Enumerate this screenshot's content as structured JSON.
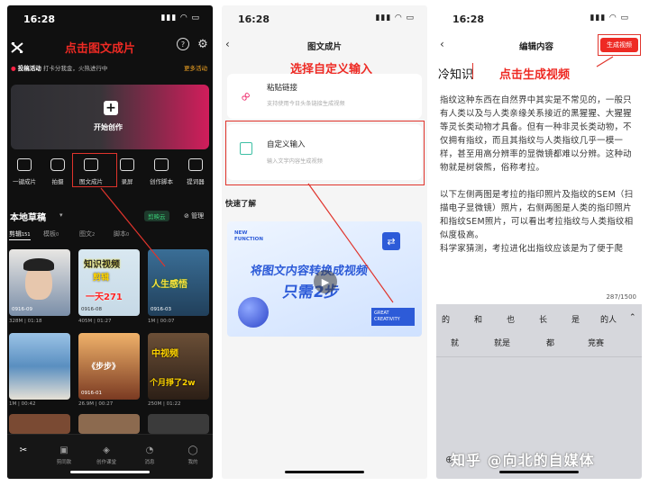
{
  "status": {
    "time": "16:28"
  },
  "phone1": {
    "annotation": "点击图文成片",
    "promo_tag": "投稿活动",
    "promo_text": "打卡分我金，火热进行中",
    "promo_more": "更多活动",
    "start_label": "开始创作",
    "tools": [
      "一键成片",
      "拍摄",
      "图文成片",
      "录屏",
      "创作脚本",
      "提词器"
    ],
    "drafts_title": "本地草稿",
    "cloud_label": "剪映云",
    "manage_label": "管理",
    "tabs": [
      "剪辑",
      "模板",
      "图文",
      "脚本"
    ],
    "tab_counts": [
      "151",
      "0",
      "2",
      "0"
    ],
    "items": [
      {
        "date": "0916-09",
        "size": "328M",
        "duration": "01:18"
      },
      {
        "date": "0916-08",
        "size": "405M",
        "duration": "01:27",
        "overlay1": "知识视频",
        "overlay2": "剪辑",
        "overlay3": "一天271"
      },
      {
        "date": "0916-03",
        "size": "1M",
        "duration": "00:07",
        "overlay1": "人生感悟"
      },
      {
        "date": "",
        "size": "1M",
        "duration": "00:42"
      },
      {
        "date": "0916-01",
        "size": "26.9M",
        "duration": "00:27",
        "overlay1": "《步步》"
      },
      {
        "date": "",
        "size": "250M",
        "duration": "01:22",
        "overlay1": "中视频",
        "overlay2": "个月掙了2w"
      }
    ],
    "nav": [
      "剪辑",
      "剪同款",
      "创作课堂",
      "消息",
      "我的"
    ]
  },
  "phone2": {
    "title": "图文成片",
    "annotation": "选择自定义输入",
    "paste_title": "粘贴链接",
    "paste_desc": "支持使用今日头条链接生成视频",
    "custom_title": "自定义输入",
    "custom_desc": "输入文字内容生成视频",
    "quick_title": "快速了解",
    "banner_small": "NEW FUNCTION",
    "banner_line1": "将图文内容转换成视频",
    "banner_line2": "只需2步",
    "banner_badge": "GREAT CREATIVITY"
  },
  "phone3": {
    "title": "编辑内容",
    "generate_label": "生成视频",
    "annotation": "点击生成视频",
    "doc_title": "冷知识",
    "body": [
      "指纹这种东西在自然界中其实是不常见的，一般只有人类以及与人类亲缘关系接近的黑猩猩、大猩猩等灵长类动物才具备。但有一种非灵长类动物，不仅拥有指纹，而且其指纹与人类指纹几乎一模一样，甚至用高分辨率的显微镜都难以分辨。这种动物就是树袋熊，俗称考拉。",
      "以下左侧两图是考拉的指印照片及指纹的SEM（扫描电子显微镜）照片，右侧两图是人类的指印照片和指纹SEM照片，可以看出考拉指纹与人类指纹相似度极高。",
      "科学家猜测，考拉进化出指纹应该是为了便于爬树，而且拥有指纹的历史应该还不长，因为与考拉亲缘关系较近的袋熊和袋鼠都没有指纹。然而考拉的指纹竟然与人类指纹如此相似，这令科学家颇感惊讶。"
    ],
    "counter": "287/1500",
    "kb_row1": [
      "的",
      "和",
      "也",
      "长",
      "是",
      "的人"
    ],
    "kb_row2": [
      "就",
      "就是",
      "都",
      "竞赛"
    ]
  },
  "watermark": "知乎 @向北的自媒体",
  "colors": {
    "accent": "#ee2a24",
    "dark_bg": "#101010",
    "brand_blue": "#2d5bd8"
  }
}
